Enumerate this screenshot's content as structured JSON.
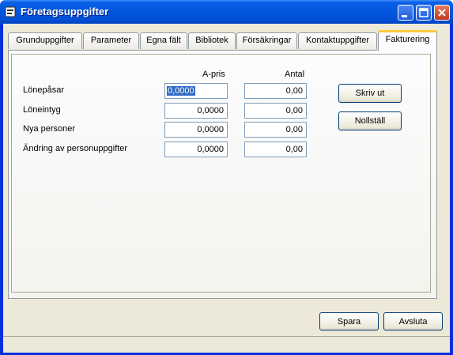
{
  "window": {
    "title": "Företagsuppgifter"
  },
  "tabs": [
    {
      "label": "Grunduppgifter"
    },
    {
      "label": "Parameter"
    },
    {
      "label": "Egna fält"
    },
    {
      "label": "Bibliotek"
    },
    {
      "label": "Försäkringar"
    },
    {
      "label": "Kontaktuppgifter"
    },
    {
      "label": "Fakturering"
    }
  ],
  "active_tab": "Fakturering",
  "columns": {
    "apris": "A-pris",
    "antal": "Antal"
  },
  "rows": [
    {
      "label": "Lönepåsar",
      "apris": "0,0000",
      "antal": "0,00"
    },
    {
      "label": "Löneintyg",
      "apris": "0,0000",
      "antal": "0,00"
    },
    {
      "label": "Nya personer",
      "apris": "0,0000",
      "antal": "0,00"
    },
    {
      "label": "Ändring av personuppgifter",
      "apris": "0,0000",
      "antal": "0,00"
    }
  ],
  "buttons": {
    "print": "Skriv ut",
    "reset": "Nollställ",
    "save": "Spara",
    "cancel": "Avsluta"
  },
  "icons": {
    "app": "app-window-icon",
    "minimize": "minimize-icon",
    "maximize": "maximize-icon",
    "close": "close-icon"
  }
}
